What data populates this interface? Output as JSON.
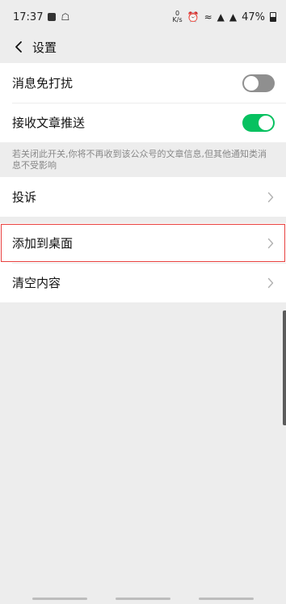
{
  "status_bar": {
    "time": "17:37",
    "speed": "0\nK/s",
    "battery": "47%"
  },
  "header": {
    "title": "设置"
  },
  "settings": {
    "mute_label": "消息免打扰",
    "mute_on": false,
    "receive_label": "接收文章推送",
    "receive_on": true,
    "receive_note": "若关闭此开关,你将不再收到该公众号的文章信息,但其他通知类消息不受影响",
    "complain_label": "投诉",
    "add_desktop_label": "添加到桌面",
    "clear_label": "清空内容"
  },
  "colors": {
    "accent": "#07c160",
    "highlight": "#e8413f",
    "toggle_off": "#8f8f8f"
  }
}
